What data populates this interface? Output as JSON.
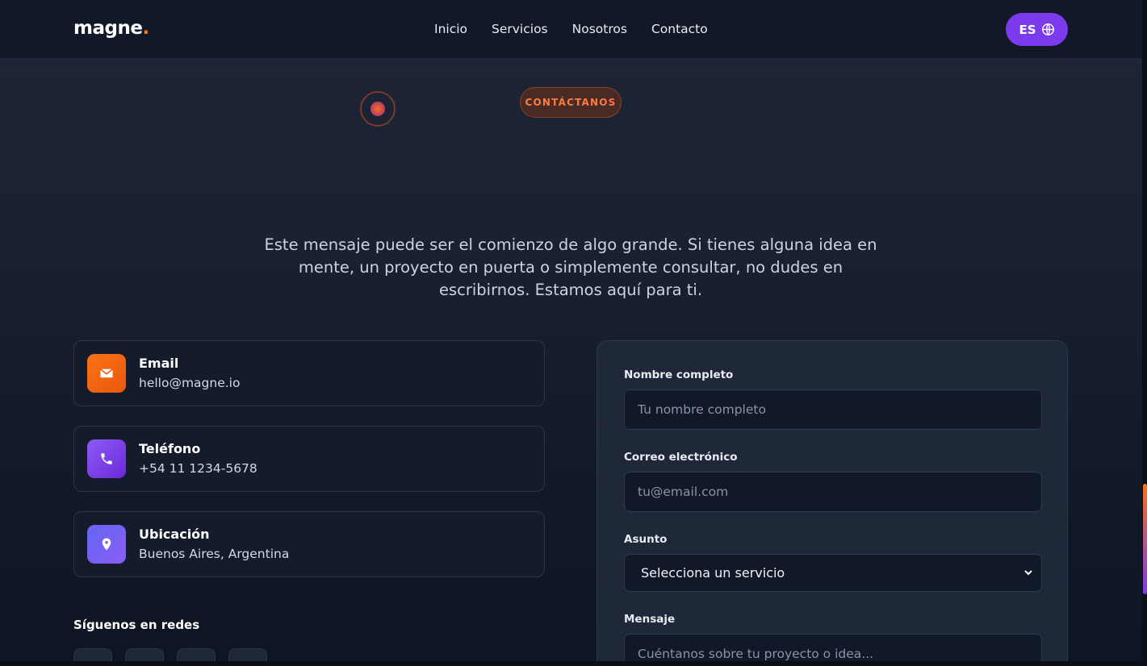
{
  "header": {
    "logo_text": "magne",
    "logo_dot": ".",
    "nav": [
      "Inicio",
      "Servicios",
      "Nosotros",
      "Contacto"
    ],
    "lang_label": "ES",
    "lang_icon": "globe-icon"
  },
  "hero": {
    "badge": "CONTÁCTANOS",
    "intro": "Este mensaje puede ser el comienzo de algo grande. Si tienes alguna idea en mente, un proyecto en puerta o simplemente consultar, no dudes en escribirnos. Estamos aquí para ti."
  },
  "contact": [
    {
      "label": "Email",
      "value": "hello@magne.io",
      "icon": "mail-icon"
    },
    {
      "label": "Teléfono",
      "value": "+54 11 1234-5678",
      "icon": "phone-icon"
    },
    {
      "label": "Ubicación",
      "value": "Buenos Aires, Argentina",
      "icon": "location-pin-icon"
    }
  ],
  "social": {
    "title": "Síguenos en redes"
  },
  "form": {
    "name_label": "Nombre completo",
    "name_placeholder": "Tu nombre completo",
    "email_label": "Correo electrónico",
    "email_placeholder": "tu@email.com",
    "subject_label": "Asunto",
    "subject_selected": "Selecciona un servicio",
    "message_label": "Mensaje",
    "message_placeholder": "Cuéntanos sobre tu proyecto o idea..."
  },
  "colors": {
    "accent_orange": "#f97316",
    "accent_purple": "#7c3aed",
    "background": "#111827"
  }
}
